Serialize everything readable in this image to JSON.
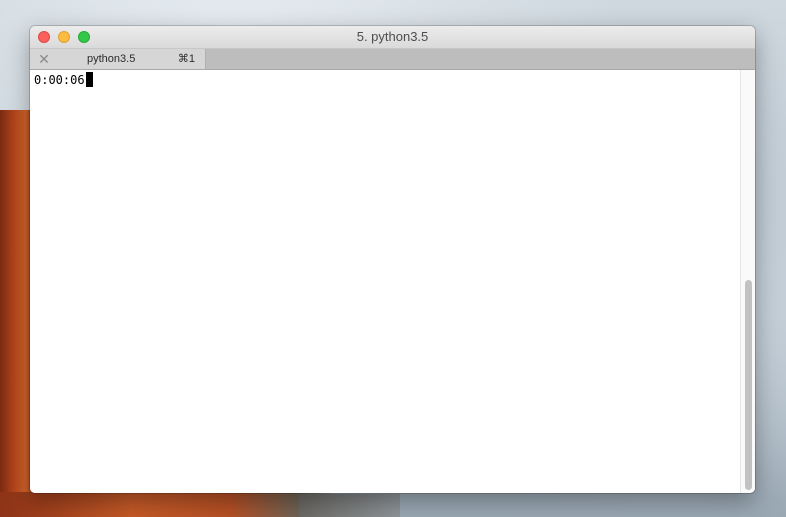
{
  "window": {
    "title": "5. python3.5"
  },
  "tabs": [
    {
      "label": "python3.5",
      "shortcut": "⌘1",
      "close_glyph": "✕"
    }
  ],
  "terminal": {
    "lines": [
      "0:00:06"
    ]
  },
  "icons": {
    "close": "close-icon",
    "minimize": "minimize-icon",
    "zoom": "zoom-icon",
    "tab_close": "tab-close-icon"
  },
  "colors": {
    "close": "#fc605c",
    "minimize": "#fdbc40",
    "zoom": "#34c84a"
  },
  "scrollbar": {
    "position": 1.0
  }
}
